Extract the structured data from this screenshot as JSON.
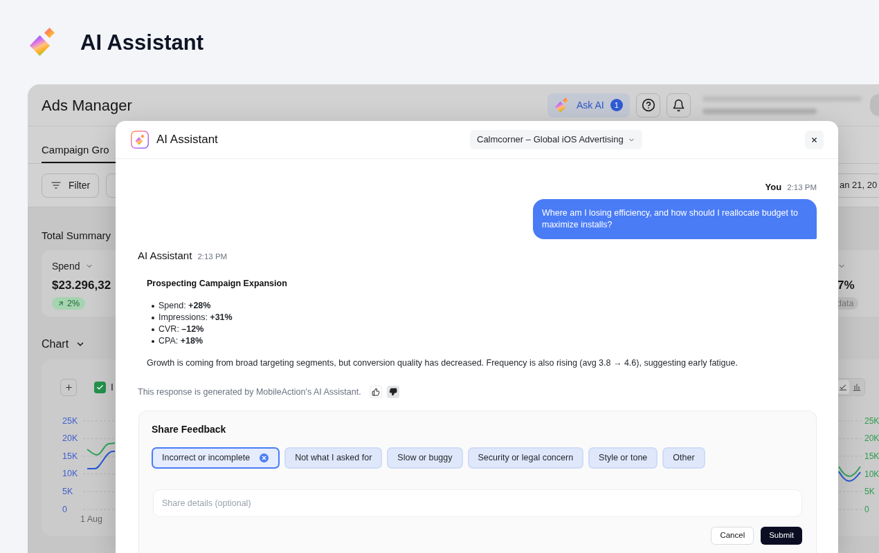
{
  "header": {
    "title": "AI Assistant"
  },
  "app": {
    "title": "Ads Manager",
    "ask_ai": {
      "label": "Ask AI",
      "badge": "1"
    },
    "tabs": [
      {
        "label": "Campaign Gro",
        "selected": true
      }
    ],
    "toolbar": {
      "filter": "Filter",
      "date": "an 21, 20"
    },
    "summary": {
      "title": "Total Summary",
      "cards": [
        {
          "label": "Spend",
          "value": "$23.296,32",
          "change": "2%",
          "kind": "rising"
        },
        {
          "value": "7%",
          "change": "data",
          "kind": "neutral"
        }
      ]
    },
    "chart": {
      "title": "Chart",
      "series_toggles": [
        {
          "label": "I",
          "checked": true
        }
      ],
      "chart_types": [
        {
          "kind": "line",
          "selected": true
        },
        {
          "kind": "bar",
          "selected": false
        }
      ],
      "left_axis": [
        "25K",
        "20K",
        "15K",
        "10K",
        "5K",
        "0"
      ],
      "right_axis": [
        "25K",
        "20K",
        "15K",
        "10K",
        "5K",
        "0"
      ],
      "x_labels": [
        "1 Aug"
      ]
    }
  },
  "assistant": {
    "title": "AI Assistant",
    "account": "Calmcorner – Global iOS Advertising",
    "messages": [
      {
        "kind": "user",
        "author": "You",
        "time": "2:13 PM",
        "text": "Where am I losing efficiency, and how should I reallocate budget to maximize installs?"
      },
      {
        "kind": "assistant",
        "author": "AI Assistant",
        "time": "2:13 PM",
        "heading": "Prospecting Campaign Expansion",
        "bullets": [
          "Spend: **+28%**",
          "Impressions: **+31%**",
          "CVR: **–12%**",
          "CPA: **+18%**"
        ],
        "paragraph": "Growth is coming from broad targeting segments, but conversion quality has decreased. Frequency is also rising (avg 3.8 → 4.6), suggesting early fatigue."
      }
    ],
    "disclaimer": "This response is generated by MobileAction's AI Assistant.",
    "ratings": [
      {
        "kind": "up",
        "selected": false
      },
      {
        "kind": "down",
        "selected": true
      }
    ],
    "feedback": {
      "title": "Share Feedback",
      "reasons": [
        {
          "label": "Incorrect or incomplete",
          "selected": true
        },
        {
          "label": "Not what I asked for",
          "selected": false
        },
        {
          "label": "Slow or buggy",
          "selected": false
        },
        {
          "label": "Security or legal concern",
          "selected": false
        },
        {
          "label": "Style or tone",
          "selected": false
        },
        {
          "label": "Other",
          "selected": false
        }
      ],
      "details": {
        "placeholder": "Share details (optional)"
      },
      "buttons": [
        {
          "kind": "secondary",
          "label": "Cancel"
        },
        {
          "kind": "primary",
          "label": "Submit"
        }
      ]
    }
  }
}
